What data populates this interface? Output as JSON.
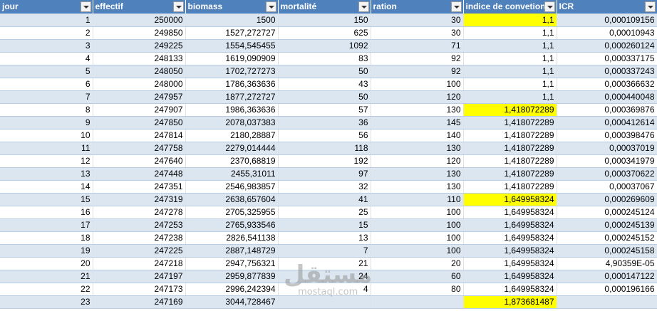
{
  "headers": [
    "jour",
    "effectif",
    "biomass",
    "mortalité",
    "ration",
    "indice de convetion",
    "ICR"
  ],
  "rows": [
    {
      "cells": [
        "1",
        "250000",
        "1500",
        "150",
        "30",
        "1,1",
        "0,000109156"
      ],
      "hl": true
    },
    {
      "cells": [
        "2",
        "249850",
        "1527,272727",
        "625",
        "30",
        "1,1",
        "0,00010943"
      ],
      "hl": false
    },
    {
      "cells": [
        "3",
        "249225",
        "1554,545455",
        "1092",
        "71",
        "1,1",
        "0,000260124"
      ],
      "hl": false
    },
    {
      "cells": [
        "4",
        "248133",
        "1619,090909",
        "83",
        "92",
        "1,1",
        "0,000337175"
      ],
      "hl": false
    },
    {
      "cells": [
        "5",
        "248050",
        "1702,727273",
        "50",
        "92",
        "1,1",
        "0,000337243"
      ],
      "hl": false
    },
    {
      "cells": [
        "6",
        "248000",
        "1786,363636",
        "43",
        "100",
        "1,1",
        "0,000366632"
      ],
      "hl": false
    },
    {
      "cells": [
        "7",
        "247957",
        "1877,272727",
        "50",
        "120",
        "1,1",
        "0,000440048"
      ],
      "hl": false
    },
    {
      "cells": [
        "8",
        "247907",
        "1986,363636",
        "57",
        "130",
        "1,418072289",
        "0,000369876"
      ],
      "hl": true
    },
    {
      "cells": [
        "9",
        "247850",
        "2078,037383",
        "36",
        "145",
        "1,418072289",
        "0,000412614"
      ],
      "hl": false
    },
    {
      "cells": [
        "10",
        "247814",
        "2180,28887",
        "56",
        "140",
        "1,418072289",
        "0,000398476"
      ],
      "hl": false
    },
    {
      "cells": [
        "11",
        "247758",
        "2279,014444",
        "118",
        "130",
        "1,418072289",
        "0,00037019"
      ],
      "hl": false
    },
    {
      "cells": [
        "12",
        "247640",
        "2370,68819",
        "192",
        "120",
        "1,418072289",
        "0,000341979"
      ],
      "hl": false
    },
    {
      "cells": [
        "13",
        "247448",
        "2455,31011",
        "97",
        "130",
        "1,418072289",
        "0,000370622"
      ],
      "hl": false
    },
    {
      "cells": [
        "14",
        "247351",
        "2546,983857",
        "32",
        "130",
        "1,418072289",
        "0,00037067"
      ],
      "hl": false
    },
    {
      "cells": [
        "15",
        "247319",
        "2638,657604",
        "41",
        "110",
        "1,649958324",
        "0,000269609"
      ],
      "hl": true
    },
    {
      "cells": [
        "16",
        "247278",
        "2705,325955",
        "25",
        "100",
        "1,649958324",
        "0,000245124"
      ],
      "hl": false
    },
    {
      "cells": [
        "17",
        "247253",
        "2765,933546",
        "15",
        "100",
        "1,649958324",
        "0,000245139"
      ],
      "hl": false
    },
    {
      "cells": [
        "18",
        "247238",
        "2826,541138",
        "13",
        "100",
        "1,649958324",
        "0,000245152"
      ],
      "hl": false
    },
    {
      "cells": [
        "19",
        "247225",
        "2887,148729",
        "7",
        "100",
        "1,649958324",
        "0,000245158"
      ],
      "hl": false
    },
    {
      "cells": [
        "20",
        "247218",
        "2947,756321",
        "21",
        "20",
        "1,649958324",
        "4,90359E-05"
      ],
      "hl": false
    },
    {
      "cells": [
        "21",
        "247197",
        "2959,877839",
        "24",
        "60",
        "1,649958324",
        "0,000147122"
      ],
      "hl": false
    },
    {
      "cells": [
        "22",
        "247173",
        "2996,242394",
        "4",
        "80",
        "1,649958324",
        "0,000196166"
      ],
      "hl": false
    },
    {
      "cells": [
        "23",
        "247169",
        "3044,728467",
        "",
        "",
        "1,873681487",
        ""
      ],
      "hl": true
    }
  ],
  "watermark": {
    "arabic": "مستقل",
    "latin": "mostaql.com"
  },
  "colors": {
    "header": "#4f81bd",
    "band": "#dce6f1",
    "highlight": "#ffff00"
  }
}
